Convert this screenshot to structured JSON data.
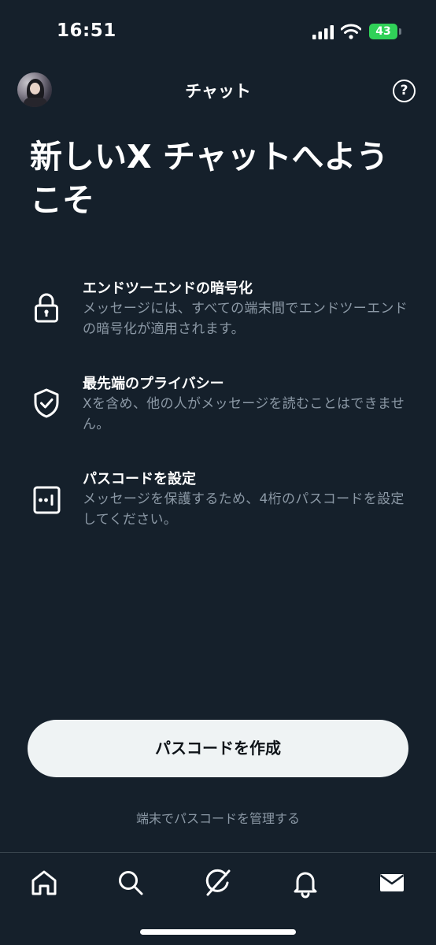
{
  "status_bar": {
    "time": "16:51",
    "battery": "43"
  },
  "header": {
    "title": "チャット",
    "help_icon": "question-circle-icon"
  },
  "welcome_title": "新しいX チャットへようこそ",
  "features": [
    {
      "icon": "lock-icon",
      "title": "エンドツーエンドの暗号化",
      "description": "メッセージには、すべての端末間でエンドツーエンドの暗号化が適用されます。"
    },
    {
      "icon": "shield-check-icon",
      "title": "最先端のプライバシー",
      "description": "Xを含め、他の人がメッセージを読むことはできません。"
    },
    {
      "icon": "passcode-icon",
      "title": "パスコードを設定",
      "description": "メッセージを保護するため、4桁のパスコードを設定してください。"
    }
  ],
  "primary_button": "パスコードを作成",
  "secondary_link": "端末でパスコードを管理する",
  "tabs": [
    {
      "icon": "home-icon"
    },
    {
      "icon": "search-icon"
    },
    {
      "icon": "grok-icon"
    },
    {
      "icon": "notifications-bell-icon"
    },
    {
      "icon": "messages-envelope-icon"
    }
  ],
  "colors": {
    "background": "#15202b",
    "secondary_text": "#8b98a5",
    "button_bg": "#eff3f4",
    "battery": "#30d158"
  }
}
